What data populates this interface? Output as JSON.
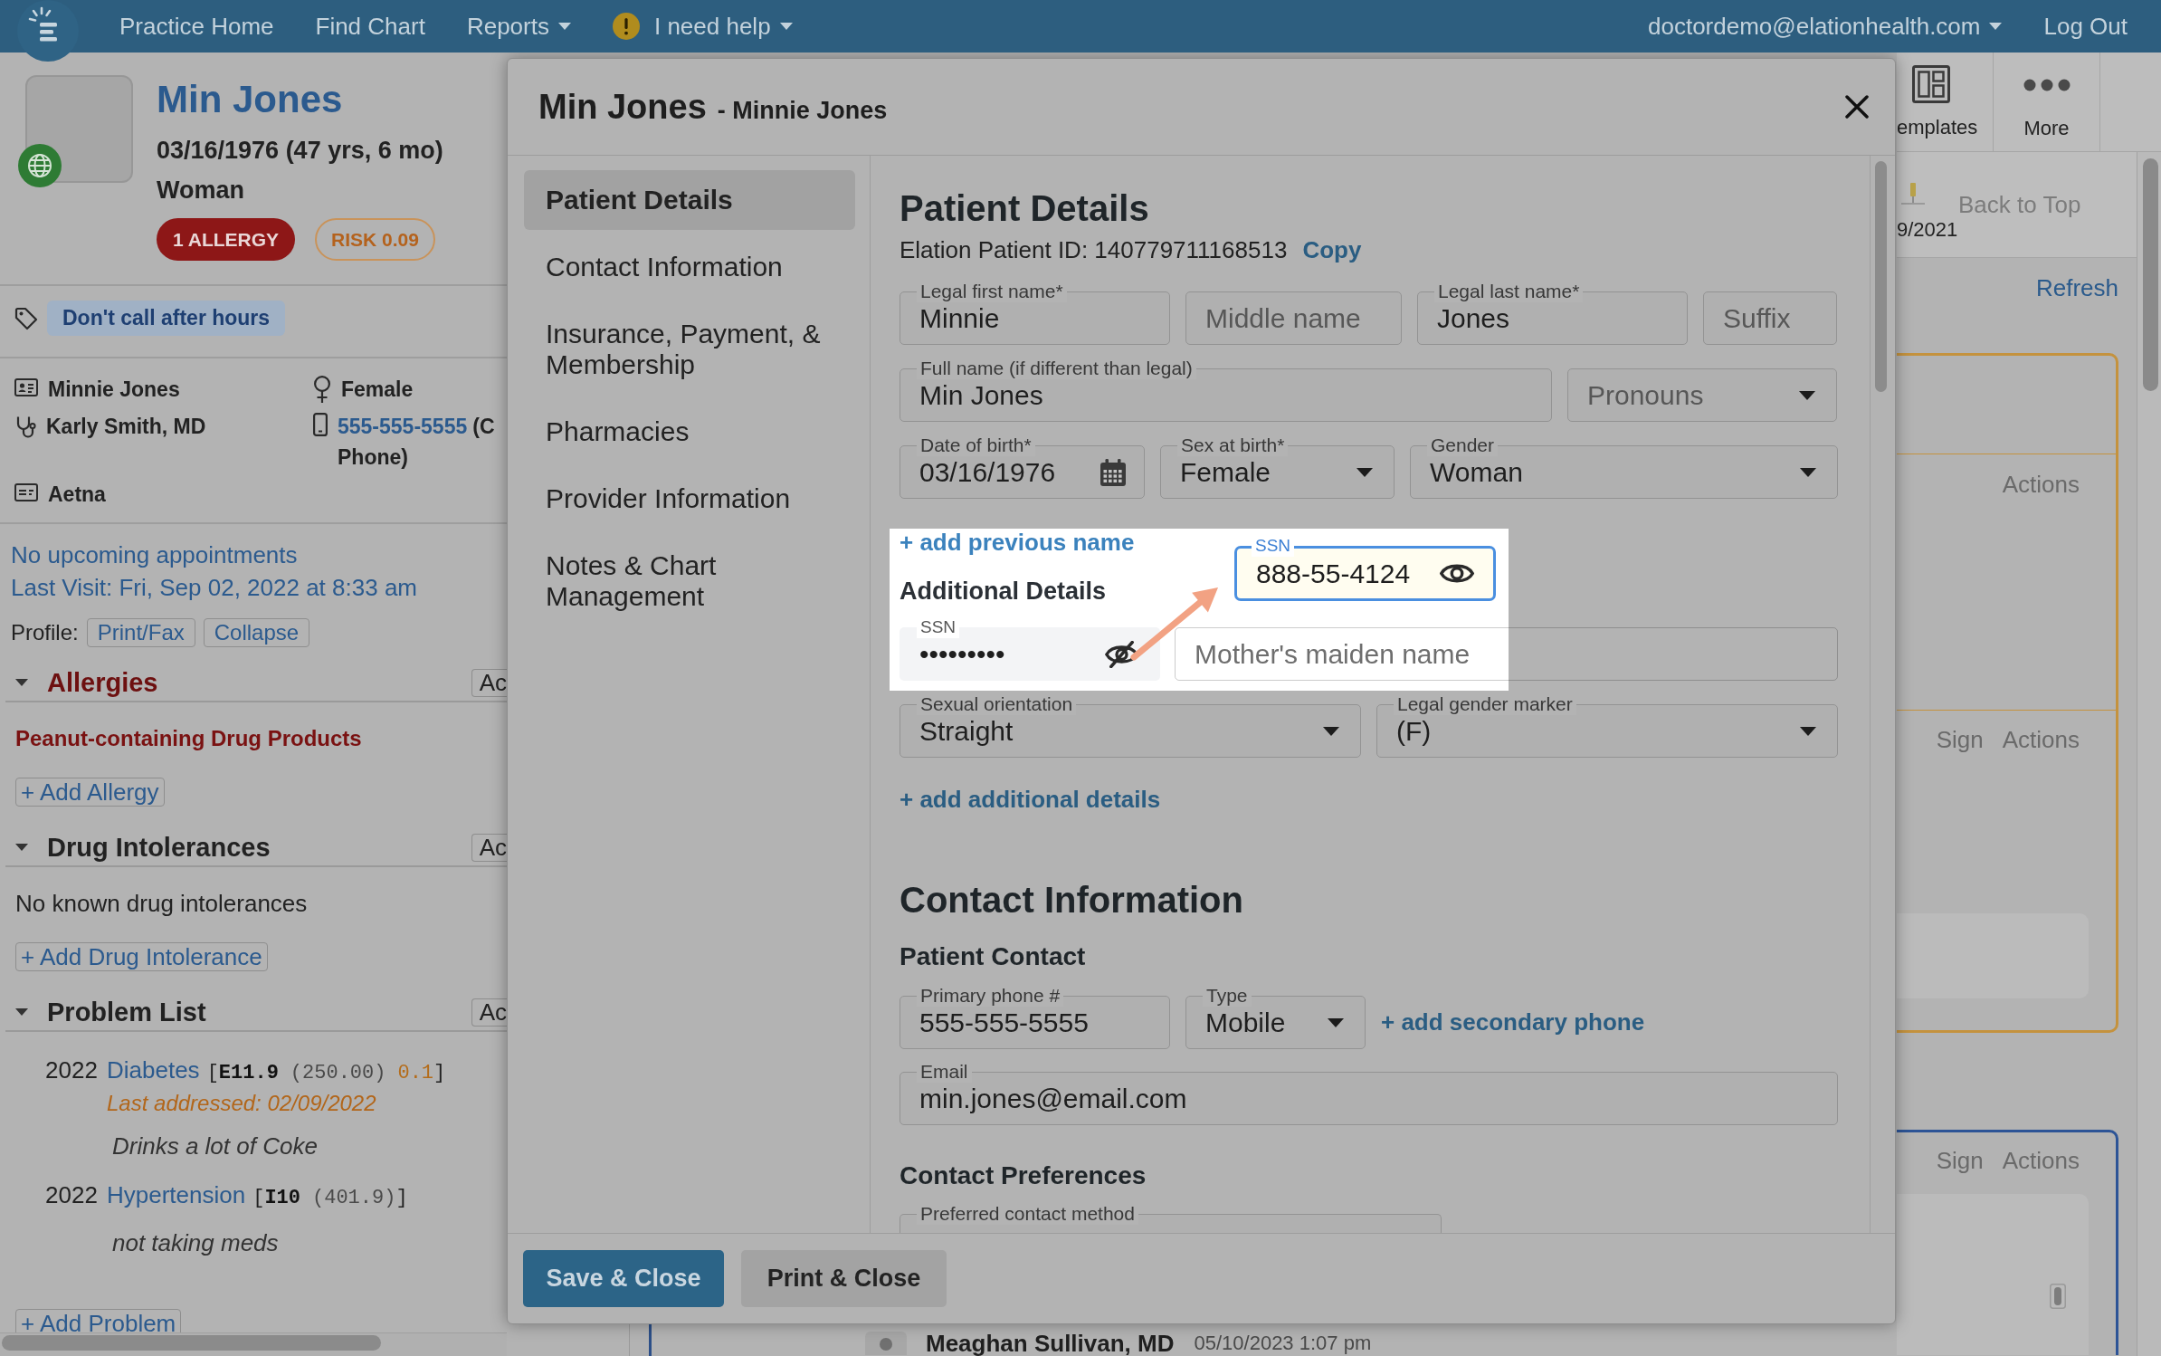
{
  "top_nav": {
    "items": [
      {
        "label": "Practice Home",
        "kind": "link"
      },
      {
        "label": "Find Chart",
        "kind": "link"
      },
      {
        "label": "Reports",
        "kind": "menu"
      },
      {
        "label": "I need help",
        "kind": "help"
      }
    ],
    "account": {
      "label": "doctordemo@elationhealth.com",
      "kind": "menu"
    },
    "logout": "Log Out"
  },
  "patient": {
    "name": "Min Jones",
    "dob": "03/16/1976 (47 yrs, 6 mo)",
    "gender": "Woman",
    "badges": [
      {
        "label": "1 ALLERGY",
        "kind": "allergy"
      },
      {
        "label": "RISK 0.09",
        "kind": "risk"
      }
    ],
    "tag": "Don't call after hours",
    "facts": [
      {
        "kind": "name",
        "text": "Minnie Jones"
      },
      {
        "kind": "sex",
        "text": "Female"
      },
      {
        "kind": "provider",
        "text": "Karly Smith, MD"
      },
      {
        "kind": "phone",
        "link": "555-555-5555",
        "note_lines": [
          "(C",
          "Phone)"
        ]
      },
      {
        "kind": "insurance",
        "text": "Aetna"
      }
    ],
    "upcoming": "No upcoming appointments",
    "last_visit": "Last Visit: Fri, Sep 02, 2022 at 8:33 am",
    "profile": {
      "label": "Profile:",
      "buttons": [
        "Print/Fax",
        "Collapse"
      ]
    }
  },
  "sections": [
    {
      "title": "Allergies",
      "kind": "allergy",
      "expanded": true,
      "action": "Ac",
      "entries": [
        {
          "kind": "allergen",
          "text": "Peanut-containing Drug Products"
        }
      ],
      "add": "+ Add Allergy"
    },
    {
      "title": "Drug Intolerances",
      "kind": "intolerance",
      "expanded": true,
      "action": "Ac",
      "entries": [
        {
          "kind": "none",
          "text": "No known drug intolerances"
        }
      ],
      "add": "+ Add Drug Intolerance"
    },
    {
      "title": "Problem List",
      "kind": "problem",
      "expanded": true,
      "action": "Ac",
      "entries": [
        {
          "kind": "problem",
          "year": "2022",
          "name": "Diabetes",
          "code": [
            {
              "kind": "open",
              "text": "["
            },
            {
              "kind": "icd10",
              "text": "E11.9"
            },
            {
              "kind": "icd9",
              "text": "(250.00)"
            },
            {
              "kind": "score",
              "text": "0.1"
            },
            {
              "kind": "close",
              "text": "]"
            }
          ],
          "last_addressed": "Last addressed: 02/09/2022",
          "note": "Drinks a lot of Coke"
        },
        {
          "kind": "problem",
          "year": "2022",
          "name": "Hypertension",
          "code": [
            {
              "kind": "open",
              "text": "["
            },
            {
              "kind": "icd10",
              "text": "I10"
            },
            {
              "kind": "icd9",
              "text": "(401.9)"
            },
            {
              "kind": "close",
              "text": "]"
            }
          ],
          "note": "not taking meds"
        }
      ],
      "add": "+ Add Problem"
    }
  ],
  "modal": {
    "title": "Min Jones",
    "subtitle": "- Minnie Jones",
    "nav": [
      {
        "label": "Patient Details",
        "selected": true
      },
      {
        "label": "Contact Information",
        "selected": false
      },
      {
        "label": "Insurance, Payment, & Membership",
        "selected": false
      },
      {
        "label": "Pharmacies",
        "selected": false
      },
      {
        "label": "Provider Information",
        "selected": false
      },
      {
        "label": "Notes & Chart Management",
        "selected": false
      }
    ],
    "details": {
      "title": "Patient Details",
      "patient_id": "Elation Patient ID: 140779711168513",
      "copy": "Copy",
      "rows": [
        {
          "fields": [
            {
              "kind": "text",
              "label": "Legal first name*",
              "value": "Minnie"
            },
            {
              "kind": "text",
              "placeholder": "Middle name"
            },
            {
              "kind": "text",
              "label": "Legal last name*",
              "value": "Jones"
            },
            {
              "kind": "text",
              "placeholder": "Suffix"
            }
          ]
        },
        {
          "fields": [
            {
              "kind": "text",
              "label": "Full name (if different than legal)",
              "value": "Min Jones"
            },
            {
              "kind": "select",
              "placeholder": "Pronouns"
            }
          ]
        },
        {
          "fields": [
            {
              "kind": "date",
              "label": "Date of birth*",
              "value": "03/16/1976"
            },
            {
              "kind": "select",
              "label": "Sex at birth*",
              "value": "Female"
            },
            {
              "kind": "select",
              "label": "Gender",
              "value": "Woman"
            }
          ]
        }
      ],
      "add_previous_name": "+ add previous name",
      "additional_title": "Additional Details",
      "ssn": {
        "label": "SSN",
        "value": "•••••••••",
        "masked": true
      },
      "maiden_name": {
        "placeholder": "Mother's maiden name"
      },
      "ssn_callout": {
        "label": "SSN",
        "value": "888-55-4124",
        "masked": false
      },
      "more_rows": [
        {
          "fields": [
            {
              "kind": "select",
              "label": "Sexual orientation",
              "value": "Straight"
            },
            {
              "kind": "select",
              "label": "Legal gender marker",
              "value": "(F)"
            }
          ]
        }
      ],
      "add_details": "+ add additional details"
    },
    "contact": {
      "title": "Contact Information",
      "subtitle": "Patient Contact",
      "phone": {
        "kind": "text",
        "label": "Primary phone #",
        "value": "555-555-5555"
      },
      "phone_type": {
        "kind": "select",
        "label": "Type",
        "value": "Mobile"
      },
      "add_phone": "+ add secondary phone",
      "email": {
        "kind": "text",
        "label": "Email",
        "value": "min.jones@email.com"
      },
      "preferences_title": "Contact Preferences",
      "preferred_method": {
        "kind": "text",
        "label": "Preferred contact method"
      }
    },
    "buttons": [
      {
        "label": "Save & Close",
        "kind": "primary"
      },
      {
        "label": "Print & Close",
        "kind": "secondary"
      }
    ]
  },
  "right_panel": {
    "toolbar": [
      {
        "label": "emplates",
        "kind": "templates"
      },
      {
        "label": "More",
        "kind": "more"
      }
    ],
    "date": "9/2021",
    "back_to_top": "Back to Top",
    "refresh": "Refresh",
    "cards": [
      {
        "color": "#c4923e",
        "sections": [
          {
            "kind": "blank"
          },
          {
            "kind": "actions",
            "actions": [
              "Actions"
            ]
          },
          {
            "kind": "note",
            "actions": [
              "Sign",
              "Actions"
            ]
          }
        ]
      },
      {
        "color": "#2d5496",
        "sections": [
          {
            "kind": "editor",
            "actions": [
              "Sign",
              "Actions"
            ]
          }
        ]
      }
    ]
  },
  "bottom_entry": {
    "author": "Meaghan Sullivan, MD",
    "timestamp": "05/10/2023 1:07 pm"
  }
}
